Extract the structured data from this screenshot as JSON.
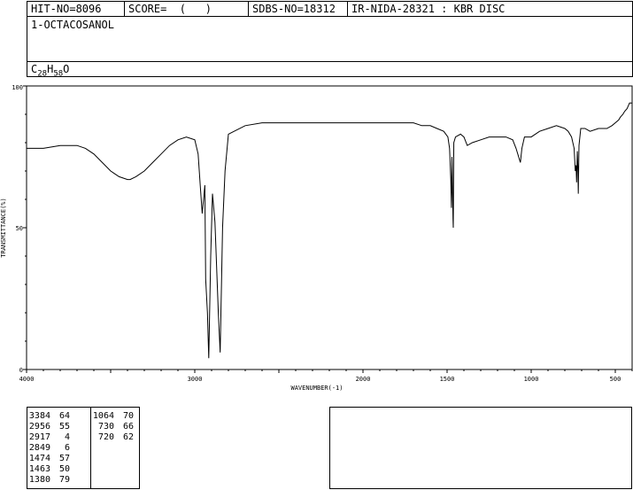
{
  "header": {
    "hit_no": "HIT-NO=8096",
    "score": "SCORE=  (   )",
    "sdbs_no": "SDBS-NO=18312",
    "ir_nida": "IR-NIDA-28321 : KBR DISC"
  },
  "compound": {
    "name": "1-OCTACOSANOL",
    "formula_c": "C",
    "formula_c_sub": "28",
    "formula_h": "H",
    "formula_h_sub": "58",
    "formula_o": "O"
  },
  "chart_data": {
    "type": "line",
    "xlabel": "WAVENUMBER(-1)",
    "ylabel": "TRANSMITTANCE(%)",
    "xlim": [
      4000,
      400
    ],
    "ylim": [
      0,
      100
    ],
    "x_ticks": [
      4000,
      3000,
      2000,
      1500,
      1000,
      500
    ],
    "y_ticks": [
      0,
      50,
      100
    ],
    "series": [
      {
        "x": [
          4000,
          3900,
          3800,
          3700,
          3650,
          3600,
          3550,
          3500,
          3450,
          3400,
          3384,
          3350,
          3300,
          3250,
          3200,
          3150,
          3100,
          3050,
          3000,
          2980,
          2965,
          2956,
          2940,
          2935,
          2925,
          2917,
          2905,
          2895,
          2880,
          2860,
          2849,
          2835,
          2820,
          2800,
          2700,
          2600,
          2500,
          2400,
          2300,
          2200,
          2100,
          2000,
          1900,
          1800,
          1700,
          1650,
          1600,
          1560,
          1520,
          1495,
          1485,
          1478,
          1474,
          1471,
          1468,
          1465,
          1463,
          1460,
          1450,
          1420,
          1400,
          1380,
          1350,
          1300,
          1250,
          1200,
          1150,
          1110,
          1090,
          1075,
          1064,
          1055,
          1040,
          1000,
          950,
          900,
          850,
          800,
          780,
          760,
          745,
          738,
          733,
          730,
          726,
          722,
          720,
          716,
          705,
          680,
          650,
          600,
          550,
          520,
          500,
          480,
          470,
          455,
          445,
          430,
          415,
          400
        ],
        "y": [
          78,
          78,
          79,
          79,
          78,
          76,
          73,
          70,
          68,
          67,
          67,
          68,
          70,
          73,
          76,
          79,
          81,
          82,
          81,
          76,
          63,
          55,
          65,
          32,
          20,
          4,
          40,
          62,
          52,
          20,
          6,
          50,
          70,
          83,
          86,
          87,
          87,
          87,
          87,
          87,
          87,
          87,
          87,
          87,
          87,
          86,
          86,
          85,
          84,
          82,
          78,
          67,
          57,
          75,
          65,
          53,
          50,
          80,
          82,
          83,
          82,
          79,
          80,
          81,
          82,
          82,
          82,
          81,
          78,
          75,
          73,
          78,
          82,
          82,
          84,
          85,
          86,
          85,
          84,
          82,
          78,
          70,
          72,
          66,
          77,
          70,
          62,
          79,
          85,
          85,
          84,
          85,
          85,
          86,
          87,
          88,
          89,
          90,
          91,
          92,
          94,
          94
        ]
      }
    ],
    "peaks_left": [
      {
        "wavenumber": "3384",
        "transmittance": "64"
      },
      {
        "wavenumber": "2956",
        "transmittance": "55"
      },
      {
        "wavenumber": "2917",
        "transmittance": "4"
      },
      {
        "wavenumber": "2849",
        "transmittance": "6"
      },
      {
        "wavenumber": "1474",
        "transmittance": "57"
      },
      {
        "wavenumber": "1463",
        "transmittance": "50"
      },
      {
        "wavenumber": "1380",
        "transmittance": "79"
      }
    ],
    "peaks_right": [
      {
        "wavenumber": "1064",
        "transmittance": "70"
      },
      {
        "wavenumber": "730",
        "transmittance": "66"
      },
      {
        "wavenumber": "720",
        "transmittance": "62"
      }
    ]
  }
}
